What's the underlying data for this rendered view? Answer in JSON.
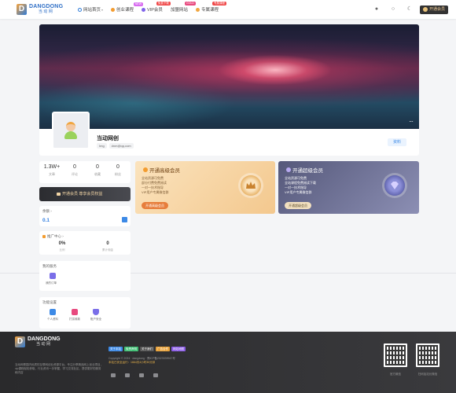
{
  "header": {
    "logo_en": "DANGDONG",
    "logo_cn": "当动网",
    "nav": [
      {
        "label": "网站首页",
        "icon": "home-icon",
        "color": "#2d7bd8",
        "arrow": true,
        "badge": "",
        "badge_color": ""
      },
      {
        "label": "创业课程",
        "icon": "course-icon",
        "color": "#f39c2f",
        "arrow": false,
        "badge": "NEW",
        "badge_color": "#d86cf0"
      },
      {
        "label": "VIP会员",
        "icon": "vip-icon",
        "color": "#7f63e9",
        "arrow": false,
        "badge": "免费下载",
        "badge_color": "#f04848"
      },
      {
        "label": "加盟网站",
        "icon": "",
        "color": "",
        "arrow": false,
        "badge": "GOLD",
        "badge_color": "#e84a7f"
      },
      {
        "label": "专属课程",
        "icon": "special-icon",
        "color": "#f0a640",
        "arrow": false,
        "badge": "专属课程",
        "badge_color": "#f04848"
      }
    ],
    "user_button": "开通会员"
  },
  "profile": {
    "name": "当动网创",
    "tags": [
      "Img",
      "dnm@qq.com"
    ],
    "info_button": "资料"
  },
  "stats": [
    {
      "value": "1.3W+",
      "label": "文章"
    },
    {
      "value": "0",
      "label": "评论"
    },
    {
      "value": "0",
      "label": "收藏"
    },
    {
      "value": "0",
      "label": "粉丝"
    }
  ],
  "vip_bar": "开通会员 尊享会员权益",
  "balance": {
    "title": "余额 ›",
    "value": "0.1"
  },
  "promo": {
    "title": "推广中心 ›",
    "items": [
      {
        "value": "0%",
        "label": "比例"
      },
      {
        "value": "0",
        "label": "累计佣金"
      }
    ]
  },
  "services": {
    "title": "我的服务",
    "items": [
      {
        "label": "我的订单"
      }
    ]
  },
  "settings": {
    "title": "功能设置",
    "items": [
      {
        "label": "个人资料",
        "color": "#3d8ae6"
      },
      {
        "label": "打赏收款",
        "color": "#e84a7f"
      },
      {
        "label": "账户安全",
        "color": "#7a6ee8"
      }
    ]
  },
  "vip_cards": [
    {
      "title": "开通高级会员",
      "features": [
        "全站资源可免费",
        "部分付费免费阅读",
        "一对一技术指导",
        "VIP用户专属微信群"
      ],
      "button": "开通高级会员",
      "title_color": "#6b3e10",
      "text_color": "#7a5a34",
      "btn_bg": "#e77d3b",
      "btn_color": "#fff"
    },
    {
      "title": "开通超级会员",
      "features": [
        "全站资源可免费",
        "全站课程免费阅读下载",
        "一对一技术指导",
        "VIP用户专属微信群"
      ],
      "button": "开通超级会员",
      "title_color": "#ffffff",
      "text_color": "#ffffff",
      "btn_bg": "#f2e0c0",
      "btn_color": "#5a4a2a"
    }
  ],
  "footer": {
    "logo_en": "DANGDONG",
    "logo_cn": "当动网",
    "description": "当动网是国内优质的互联网创业资源平台，专注分享精品网上创业项目，vip课程轻松获取，行业资讯一手掌握，学习交流社区，提供更好的服务和内容",
    "links": [
      {
        "label": "关于本站",
        "bg": "#3d8ae6"
      },
      {
        "label": "免责声明",
        "bg": "#3fbf74"
      },
      {
        "label": "关于我们",
        "bg": "#555"
      },
      {
        "label": "广告合作",
        "bg": "#e8a23a"
      },
      {
        "label": "网站地图",
        "bg": "#8a5ae6"
      }
    ],
    "copyright": "Copyright © 2024 · dangdong · 豫ICP备2023039947号",
    "notice": "本站已安全运行：1664天4小时30分钟",
    "qr": [
      {
        "label": "官方微信"
      },
      {
        "label": "扫码加站长微信"
      }
    ]
  }
}
